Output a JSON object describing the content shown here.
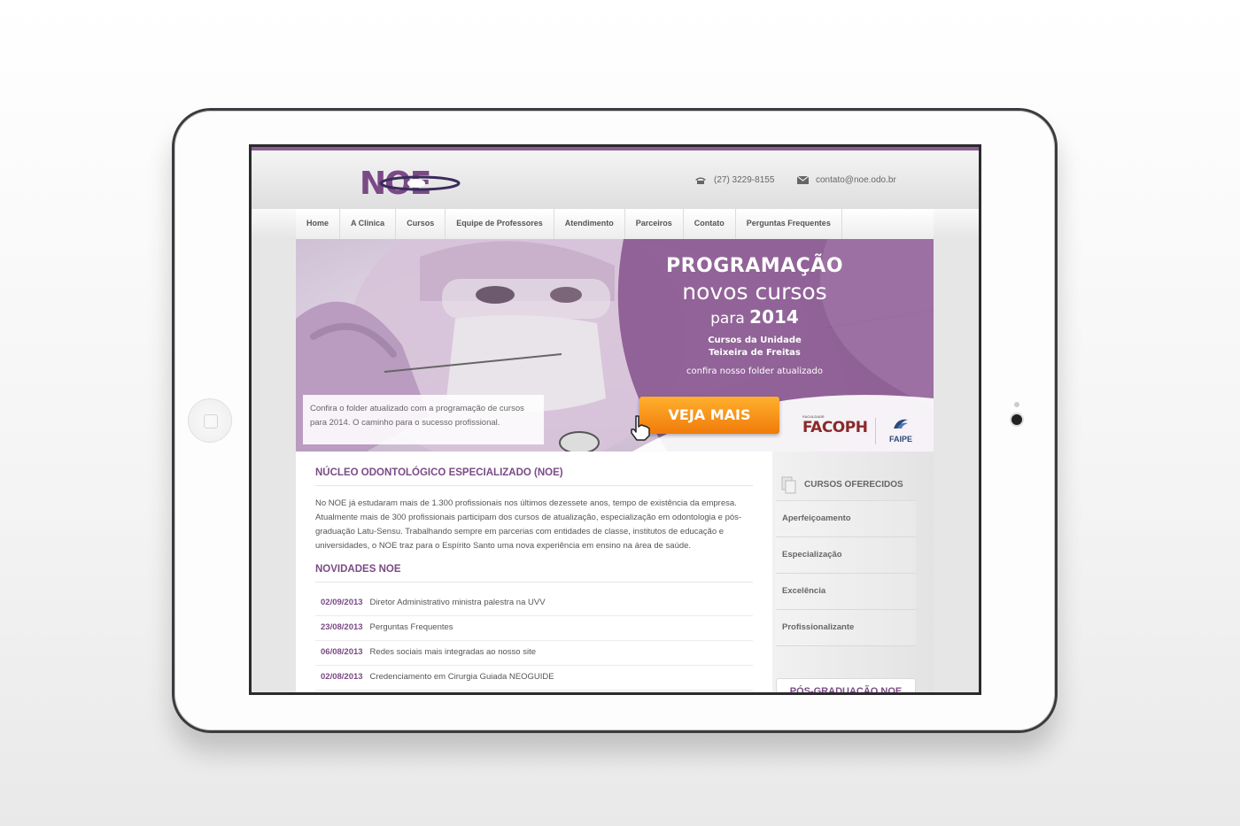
{
  "header": {
    "logo_text": "NOE",
    "phone": "(27) 3229-8155",
    "email": "contato@noe.odo.br"
  },
  "nav": {
    "items": [
      "Home",
      "A Clinica",
      "Cursos",
      "Equipe de Professores",
      "Atendimento",
      "Parceiros",
      "Contato",
      "Perguntas Frequentes"
    ]
  },
  "hero": {
    "title": "PROGRAMAÇÃO",
    "subtitle": "novos cursos",
    "year_prefix": "para",
    "year": "2014",
    "unit_line1": "Cursos da Unidade",
    "unit_line2": "Teixeira de Freitas",
    "folder_text": "confira nosso folder atualizado",
    "cta_label": "VEJA MAIS",
    "caption": "Confira o folder atualizado com a programação de cursos para 2014. O caminho para o sucesso profissional.",
    "partner1_small": "FACULDADE",
    "partner1": "FACOPH",
    "partner2": "FAIPE"
  },
  "main": {
    "section_title": "NÚCLEO ODONTOLÓGICO ESPECIALIZADO (NOE)",
    "about_text": "No NOE já estudaram mais de 1.300 profissionais nos últimos dezessete anos, tempo de existência da empresa. Atualmente mais de 300 profissionais participam dos cursos de atualização, especialização em odontologia e pós-graduação Latu-Sensu. Trabalhando sempre em parcerias com entidades de classe, institutos de educação e universidades, o NOE traz para o Espírito Santo uma nova experiência em ensino na área de saúde.",
    "news_title": "NOVIDADES NOE",
    "news": [
      {
        "date": "02/09/2013",
        "title": "Diretor Administrativo ministra palestra na UVV"
      },
      {
        "date": "23/08/2013",
        "title": "Perguntas Frequentes"
      },
      {
        "date": "06/08/2013",
        "title": "Redes sociais mais integradas ao nosso site"
      },
      {
        "date": "02/08/2013",
        "title": "Credenciamento em Cirurgia Guiada NEOGUIDE"
      }
    ]
  },
  "sidebar": {
    "title": "CURSOS OFERECIDOS",
    "items": [
      "Aperfeiçoamento",
      "Especialização",
      "Excelência",
      "Profissionalizante"
    ],
    "box_title": "PÓS-GRADUAÇÃO NOE"
  },
  "colors": {
    "brand_purple": "#7b4a86",
    "cta_orange": "#f07b0a"
  }
}
